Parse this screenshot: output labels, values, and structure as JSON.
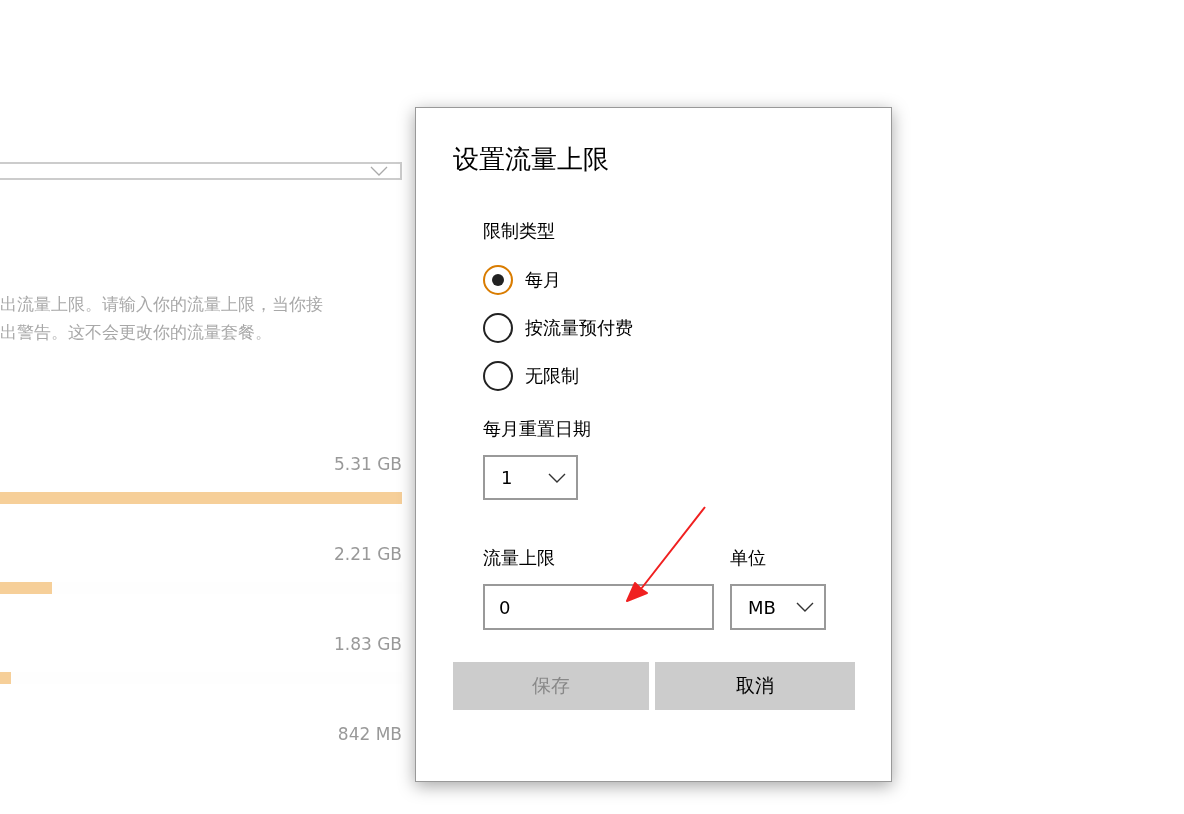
{
  "background": {
    "description": [
      "出流量上限。请输入你的流量上限，当你接",
      "出警告。这不会更改你的流量套餐。"
    ],
    "usage": [
      {
        "amount": "5.31 GB",
        "level": 1.0
      },
      {
        "amount": "2.21 GB",
        "level": 0.13
      },
      {
        "amount": "1.83 GB",
        "level": 0.027
      },
      {
        "amount": "842 MB"
      }
    ]
  },
  "dialog": {
    "title": "设置流量上限",
    "limit_type": {
      "label": "限制类型",
      "options": [
        {
          "label": "每月",
          "selected": true
        },
        {
          "label": "按流量预付费",
          "selected": false
        },
        {
          "label": "无限制",
          "selected": false
        }
      ]
    },
    "reset_day": {
      "label": "每月重置日期",
      "value": "1"
    },
    "data_limit": {
      "label": "流量上限",
      "value": "0"
    },
    "unit": {
      "label": "单位",
      "value": "MB"
    },
    "buttons": [
      {
        "label": "保存",
        "disabled": true
      },
      {
        "label": "取消",
        "disabled": false
      }
    ]
  }
}
